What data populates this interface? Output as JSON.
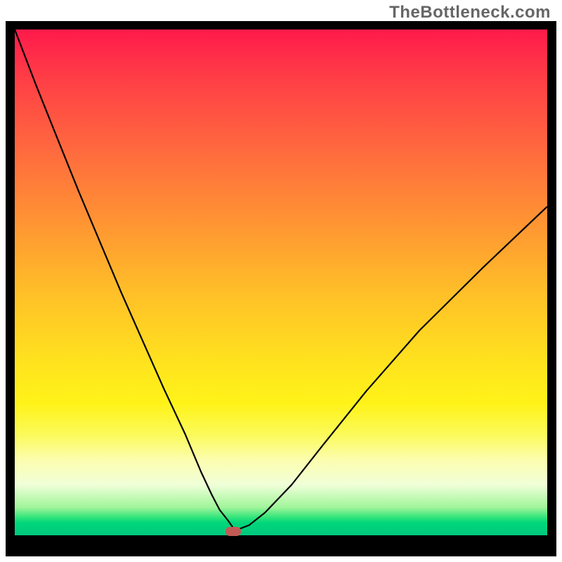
{
  "watermark": "TheBottleneck.com",
  "chart_data": {
    "type": "line",
    "title": "",
    "xlabel": "",
    "ylabel": "",
    "xlim": [
      0,
      100
    ],
    "ylim": [
      0,
      100
    ],
    "grid": false,
    "legend": false,
    "series": [
      {
        "name": "bottleneck-curve",
        "x": [
          0,
          4,
          8,
          12,
          16,
          20,
          24,
          28,
          32,
          35,
          37,
          38.5,
          40,
          41,
          42,
          44,
          47,
          52,
          58,
          66,
          76,
          88,
          100
        ],
        "y": [
          100,
          89,
          78.5,
          68,
          58,
          48,
          38.5,
          29,
          20,
          12.5,
          8,
          5,
          3,
          1.5,
          1.2,
          2,
          4.5,
          10,
          18,
          28.5,
          40.5,
          53,
          65
        ]
      }
    ],
    "marker": {
      "name": "optimal-point",
      "x": 41,
      "y": 0.8
    },
    "gradient_stops": [
      {
        "pos": 0,
        "color": "#ff1a4b"
      },
      {
        "pos": 10,
        "color": "#ff3f46"
      },
      {
        "pos": 24,
        "color": "#ff6a3e"
      },
      {
        "pos": 38,
        "color": "#ff9433"
      },
      {
        "pos": 52,
        "color": "#ffbf28"
      },
      {
        "pos": 66,
        "color": "#ffe31e"
      },
      {
        "pos": 74,
        "color": "#fff319"
      },
      {
        "pos": 80,
        "color": "#fbfa59"
      },
      {
        "pos": 85,
        "color": "#fcfdae"
      },
      {
        "pos": 90,
        "color": "#f0ffd8"
      },
      {
        "pos": 94.5,
        "color": "#9ff59a"
      },
      {
        "pos": 96.5,
        "color": "#2fe47a"
      },
      {
        "pos": 97.5,
        "color": "#00d67a"
      },
      {
        "pos": 100,
        "color": "#00c97e"
      }
    ]
  }
}
